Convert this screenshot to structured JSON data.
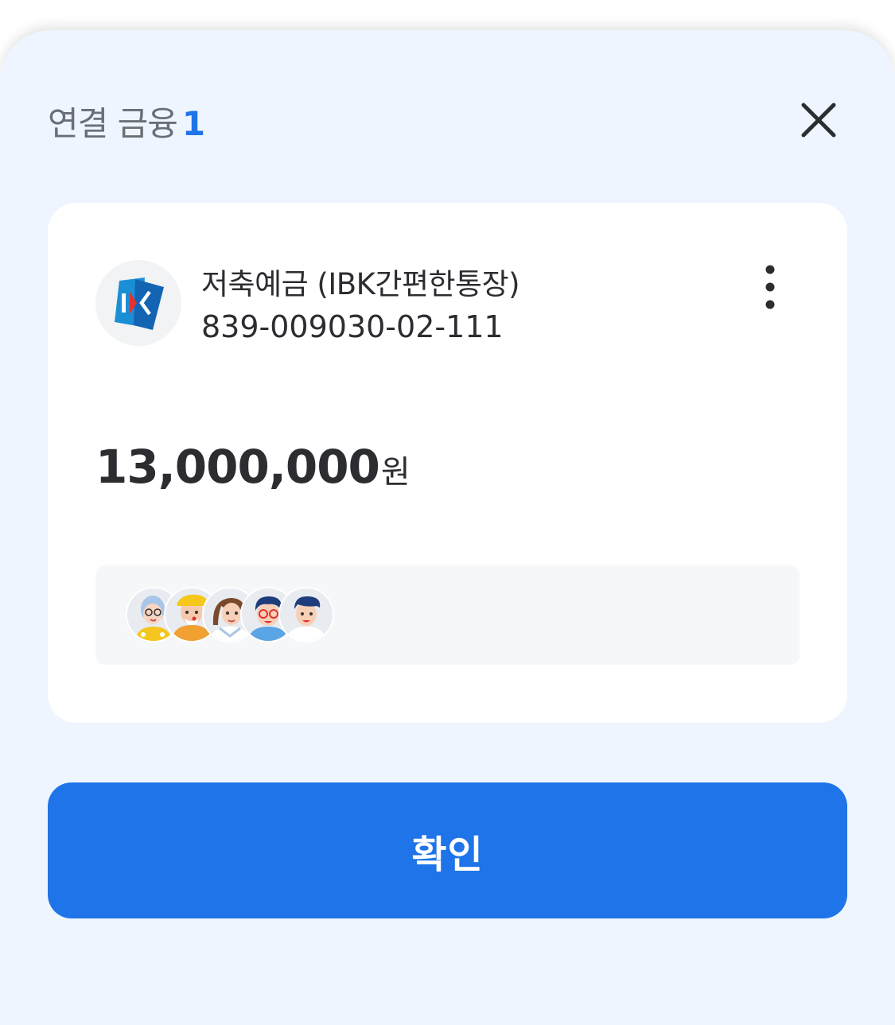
{
  "sheet": {
    "title": "연결 금융",
    "count": "1",
    "close_icon": "close-icon"
  },
  "account": {
    "logo_icon": "ibk-bank-logo",
    "name": "저축예금 (IBK간편한통장)",
    "number": "839-009030-02-111",
    "more_icon": "more-vertical-icon",
    "balance": "13,000,000",
    "currency": "원"
  },
  "members": {
    "avatars": [
      "elderly-woman-avatar",
      "elderly-man-avatar",
      "woman-avatar",
      "man-glasses-avatar",
      "young-man-avatar"
    ]
  },
  "footer": {
    "confirm_label": "확인"
  },
  "colors": {
    "accent": "#1e74e8",
    "sheet_bg": "#eef5fe",
    "card_bg": "#ffffff",
    "text": "#2b2d31",
    "muted": "#6b6f75"
  }
}
